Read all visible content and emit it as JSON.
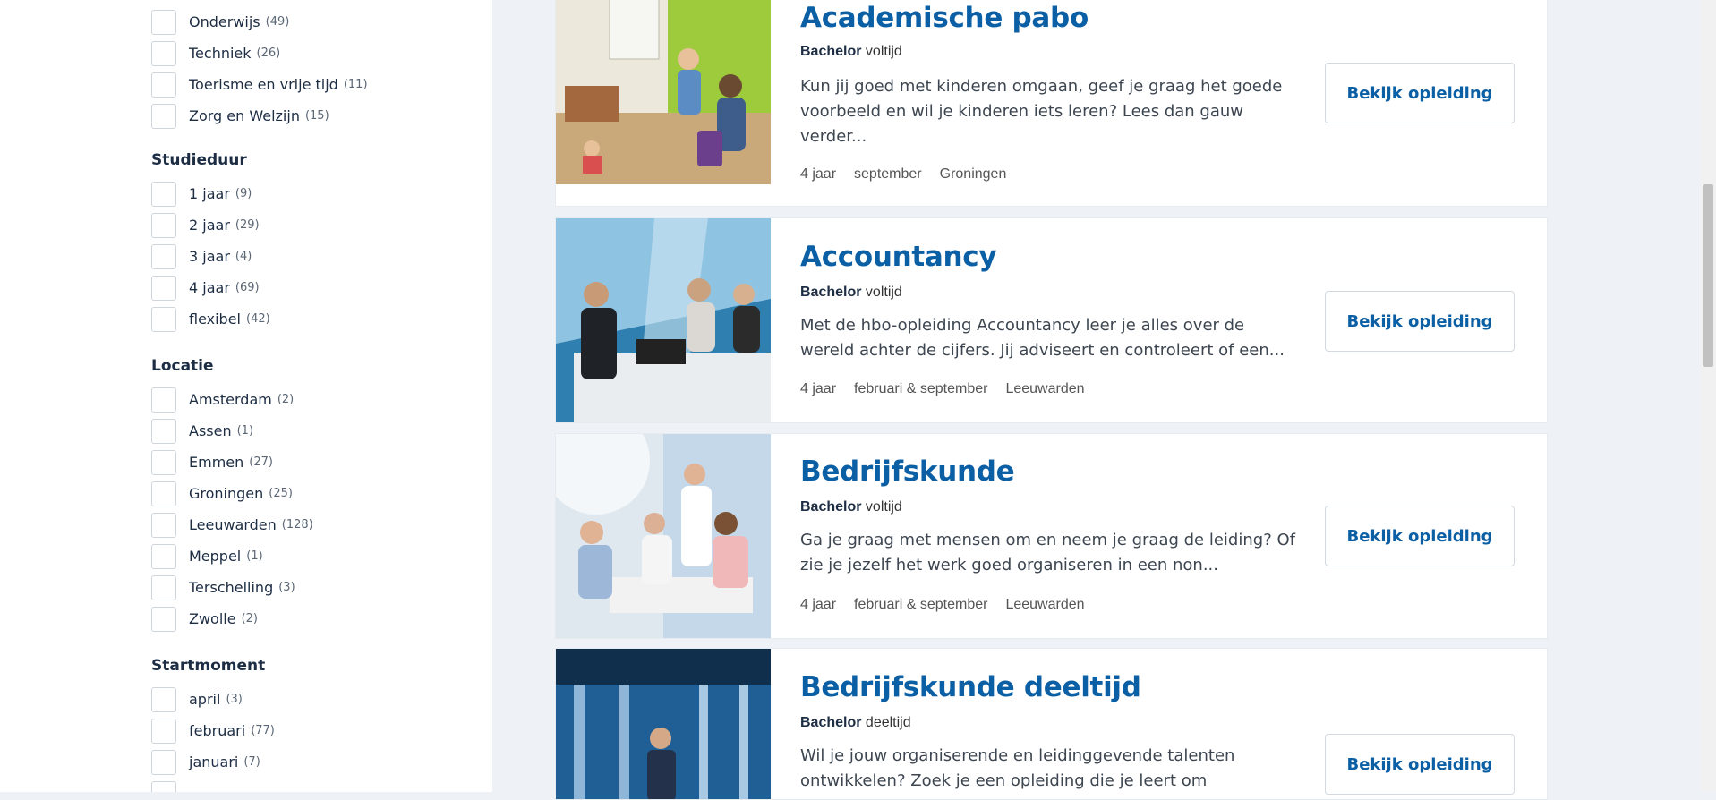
{
  "sidebar": {
    "opleidingsgebied": [
      {
        "label": "Onderwijs",
        "count": "(49)"
      },
      {
        "label": "Techniek",
        "count": "(26)"
      },
      {
        "label": "Toerisme en vrije tijd",
        "count": "(11)"
      },
      {
        "label": "Zorg en Welzijn",
        "count": "(15)"
      }
    ],
    "studieduur": {
      "heading": "Studieduur",
      "options": [
        {
          "label": "1 jaar",
          "count": "(9)"
        },
        {
          "label": "2 jaar",
          "count": "(29)"
        },
        {
          "label": "3 jaar",
          "count": "(4)"
        },
        {
          "label": "4 jaar",
          "count": "(69)"
        },
        {
          "label": "flexibel",
          "count": "(42)"
        }
      ]
    },
    "locatie": {
      "heading": "Locatie",
      "options": [
        {
          "label": "Amsterdam",
          "count": "(2)"
        },
        {
          "label": "Assen",
          "count": "(1)"
        },
        {
          "label": "Emmen",
          "count": "(27)"
        },
        {
          "label": "Groningen",
          "count": "(25)"
        },
        {
          "label": "Leeuwarden",
          "count": "(128)"
        },
        {
          "label": "Meppel",
          "count": "(1)"
        },
        {
          "label": "Terschelling",
          "count": "(3)"
        },
        {
          "label": "Zwolle",
          "count": "(2)"
        }
      ]
    },
    "startmoment": {
      "heading": "Startmoment",
      "options": [
        {
          "label": "april",
          "count": "(3)"
        },
        {
          "label": "februari",
          "count": "(77)"
        },
        {
          "label": "januari",
          "count": "(7)"
        }
      ]
    }
  },
  "programs": [
    {
      "title": "Academische pabo",
      "degree": "Bachelor",
      "mode": "voltijd",
      "description": "Kun jij goed met kinderen omgaan, geef je graag het goede voorbeeld en wil je kinderen iets leren? Lees dan gauw verder...",
      "duration": "4 jaar",
      "start": "september",
      "location": "Groningen",
      "button": "Bekijk opleiding"
    },
    {
      "title": "Accountancy",
      "degree": "Bachelor",
      "mode": "voltijd",
      "description": "Met de hbo-opleiding Accountancy leer je alles over de wereld achter de cijfers. Jij adviseert en controleert of een...",
      "duration": "4 jaar",
      "start": "februari & september",
      "location": "Leeuwarden",
      "button": "Bekijk opleiding"
    },
    {
      "title": "Bedrijfskunde",
      "degree": "Bachelor",
      "mode": "voltijd",
      "description": "Ga je graag met mensen om en neem je graag de leiding? Of zie je jezelf het werk goed organiseren in een non...",
      "duration": "4 jaar",
      "start": "februari & september",
      "location": "Leeuwarden",
      "button": "Bekijk opleiding"
    },
    {
      "title": "Bedrijfskunde deeltijd",
      "degree": "Bachelor",
      "mode": "deeltijd",
      "description": "Wil je jouw organiserende en leidinggevende talenten ontwikkelen? Zoek je een opleiding die je leert om",
      "button": "Bekijk opleiding"
    }
  ],
  "colors": {
    "accent": "#0b5fa5",
    "heading": "#1d2d44",
    "background": "#eef2f6"
  }
}
